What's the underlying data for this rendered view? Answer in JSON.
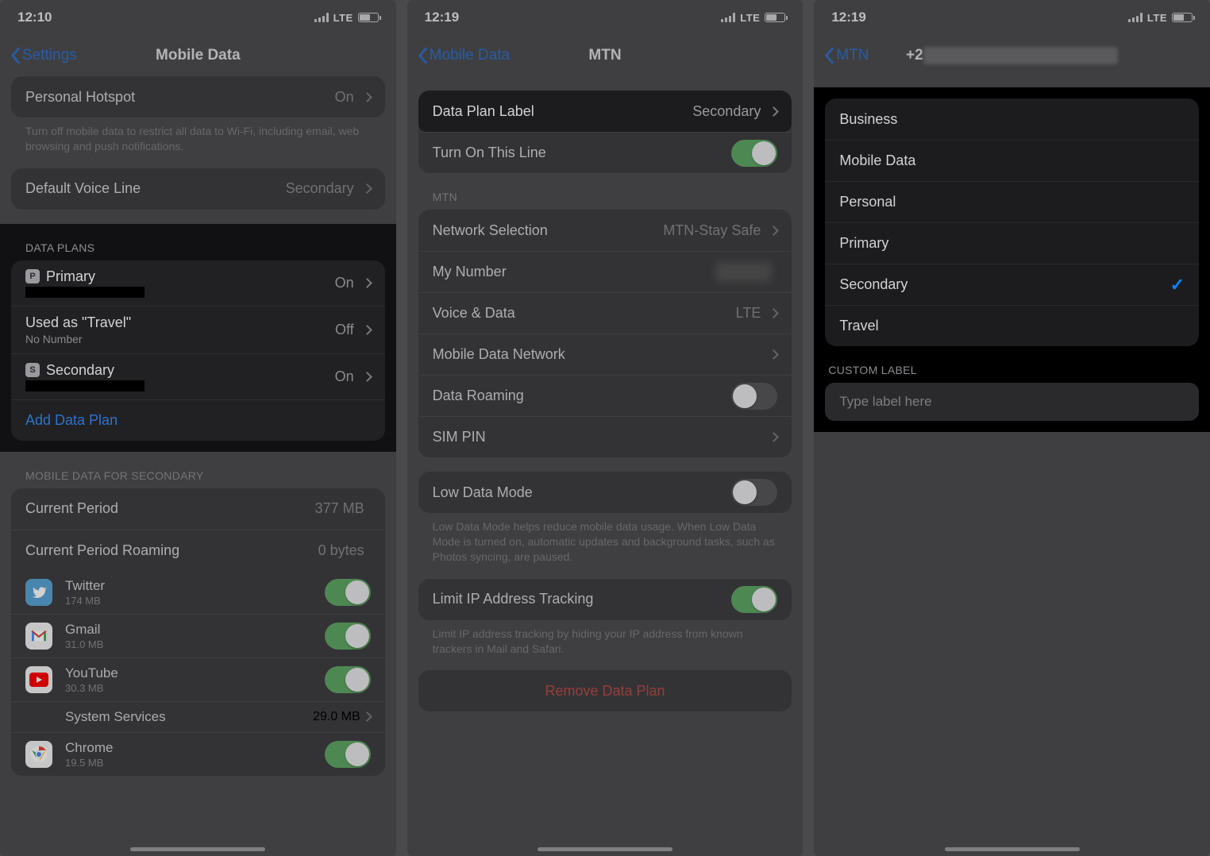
{
  "screen1": {
    "time": "12:10",
    "network_label": "LTE",
    "back": "Settings",
    "title": "Mobile Data",
    "personal_hotspot": {
      "label": "Personal Hotspot",
      "value": "On"
    },
    "hotspot_footer": "Turn off mobile data to restrict all data to Wi-Fi, including email, web browsing and push notifications.",
    "default_voice": {
      "label": "Default Voice Line",
      "value": "Secondary"
    },
    "data_plans_header": "DATA PLANS",
    "plans": [
      {
        "badge": "P",
        "label": "Primary",
        "sub_redacted": true,
        "value": "On"
      },
      {
        "badge": "",
        "label": "Used as \"Travel\"",
        "sub": "No Number",
        "value": "Off"
      },
      {
        "badge": "S",
        "label": "Secondary",
        "sub_redacted": true,
        "value": "On"
      }
    ],
    "add_plan": "Add Data Plan",
    "mobile_data_for_header": "MOBILE DATA FOR SECONDARY",
    "current_period": {
      "label": "Current Period",
      "value": "377 MB"
    },
    "current_period_roaming": {
      "label": "Current Period Roaming",
      "value": "0 bytes"
    },
    "apps": [
      {
        "name": "Twitter",
        "sub": "174 MB",
        "icon": "twitter",
        "on": true
      },
      {
        "name": "Gmail",
        "sub": "31.0 MB",
        "icon": "gmail",
        "on": true
      },
      {
        "name": "YouTube",
        "sub": "30.3 MB",
        "icon": "youtube",
        "on": true
      },
      {
        "name": "System Services",
        "sub": "",
        "icon": "",
        "value": "29.0 MB"
      },
      {
        "name": "Chrome",
        "sub": "19.5 MB",
        "icon": "chrome",
        "on": true
      }
    ]
  },
  "screen2": {
    "time": "12:19",
    "network_label": "LTE",
    "back": "Mobile Data",
    "title": "MTN",
    "data_plan_label": {
      "label": "Data Plan Label",
      "value": "Secondary"
    },
    "turn_on": {
      "label": "Turn On This Line",
      "on": true
    },
    "carrier_header": "MTN",
    "rows": {
      "network_selection": {
        "label": "Network Selection",
        "value": "MTN-Stay Safe"
      },
      "my_number": {
        "label": "My Number",
        "value_obscured": true
      },
      "voice_data": {
        "label": "Voice & Data",
        "value": "LTE"
      },
      "mdn": {
        "label": "Mobile Data Network"
      },
      "data_roaming": {
        "label": "Data Roaming",
        "on": false
      },
      "sim_pin": {
        "label": "SIM PIN"
      }
    },
    "low_data": {
      "label": "Low Data Mode",
      "on": false
    },
    "low_data_footer": "Low Data Mode helps reduce mobile data usage. When Low Data Mode is turned on, automatic updates and background tasks, such as Photos syncing, are paused.",
    "limit_ip": {
      "label": "Limit IP Address Tracking",
      "on": true
    },
    "limit_ip_footer": "Limit IP address tracking by hiding your IP address from known trackers in Mail and Safari.",
    "remove": "Remove Data Plan"
  },
  "screen3": {
    "time": "12:19",
    "network_label": "LTE",
    "back": "MTN",
    "title_obscured_prefix": "+2",
    "labels": [
      "Business",
      "Mobile Data",
      "Personal",
      "Primary",
      "Secondary",
      "Travel"
    ],
    "selected_index": 4,
    "custom_header": "CUSTOM LABEL",
    "custom_placeholder": "Type label here"
  }
}
